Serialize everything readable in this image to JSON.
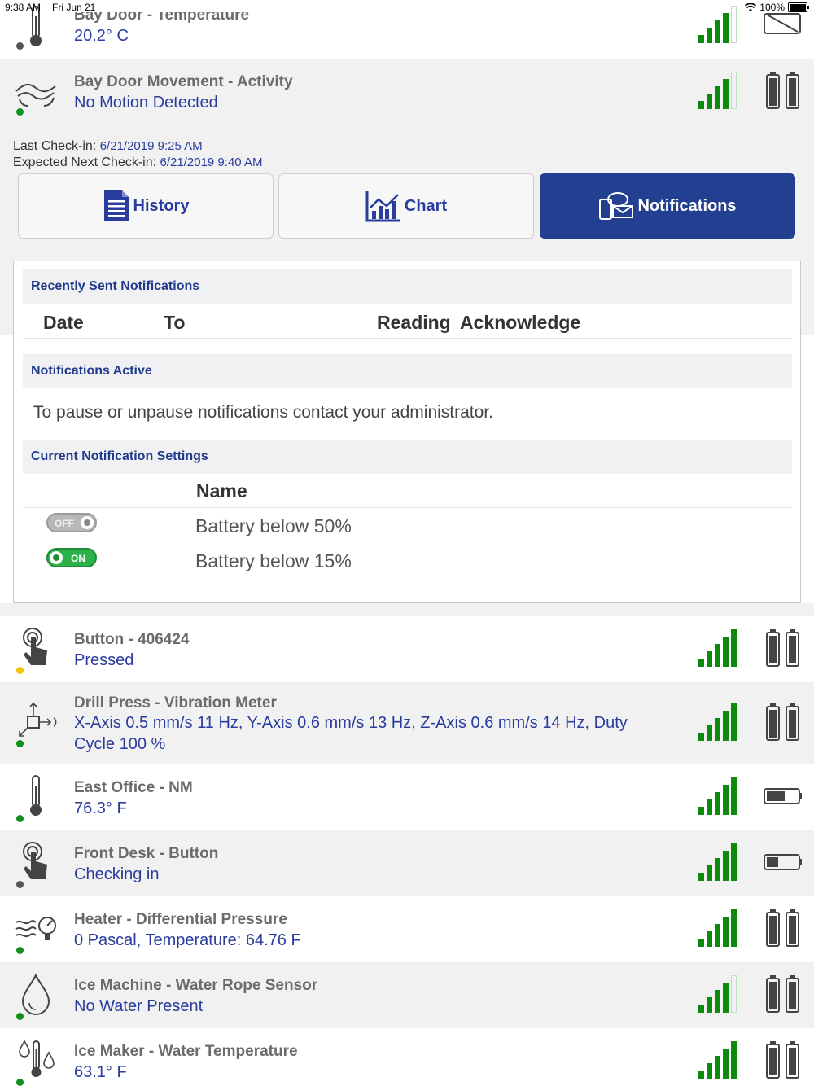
{
  "status": {
    "time": "9:38 AM",
    "date": "Fri Jun 21",
    "battery_pct": "100%"
  },
  "colors": {
    "accent": "#233f91",
    "reading": "#2a3c9e",
    "signal": "#0b8a0b",
    "dot_green": "#0f8f1c",
    "dot_gray": "#555555",
    "dot_yellow": "#f2c500"
  },
  "top_sensor": {
    "title": "Bay Door - Temperature",
    "reading": "20.2° C",
    "icon": "thermometer-icon",
    "status": "gray"
  },
  "selected_sensor": {
    "title": "Bay Door Movement - Activity",
    "reading": "No Motion Detected",
    "icon": "motion-icon",
    "status": "green"
  },
  "checkin": {
    "last_label": "Last Check-in:",
    "last_value": "6/21/2019 9:25 AM",
    "next_label": "Expected Next Check-in:",
    "next_value": "6/21/2019 9:40 AM"
  },
  "tabs": [
    {
      "label": "History",
      "icon": "document-icon"
    },
    {
      "label": "Chart",
      "icon": "chart-icon"
    },
    {
      "label": "Notifications",
      "icon": "notifications-icon",
      "active": true
    }
  ],
  "notifications": {
    "recent_heading": "Recently Sent Notifications",
    "columns": [
      "Date",
      "To",
      "Reading",
      "Acknowledge"
    ],
    "active_heading": "Notifications Active",
    "active_text": "To pause or unpause notifications contact your administrator.",
    "settings_heading": "Current Notification Settings",
    "settings_column": "Name",
    "settings": [
      {
        "state": "OFF",
        "name": "Battery below 50%"
      },
      {
        "state": "ON",
        "name": "Battery below 15%"
      }
    ]
  },
  "sensors": [
    {
      "title": "Button - 406424",
      "reading": "Pressed",
      "icon": "button-press-icon",
      "status": "yellow",
      "signal_bars": 5,
      "battery": "full-icon"
    },
    {
      "title": "Drill Press - Vibration Meter",
      "reading": "X-Axis 0.5 mm/s 11 Hz, Y-Axis 0.6 mm/s 13 Hz, Z-Axis 0.6 mm/s 14 Hz, Duty Cycle 100 %",
      "icon": "vibration-icon",
      "status": "green",
      "signal_bars": 5,
      "battery": "full-icon"
    },
    {
      "title": "East Office - NM",
      "reading": "76.3° F",
      "icon": "thermometer-icon",
      "status": "green",
      "signal_bars": 5,
      "battery": "coin-cell-icon"
    },
    {
      "title": "Front Desk - Button",
      "reading": "Checking in",
      "icon": "button-press-icon",
      "status": "gray",
      "signal_bars": 5,
      "battery": "coin-cell-icon"
    },
    {
      "title": "Heater - Differential Pressure",
      "reading": "0 Pascal, Temperature: 64.76 F",
      "icon": "pressure-icon",
      "status": "green",
      "signal_bars": 5,
      "battery": "full-icon"
    },
    {
      "title": "Ice Machine - Water Rope Sensor",
      "reading": "No Water Present",
      "icon": "water-drop-icon",
      "status": "green",
      "signal_bars": 4,
      "battery": "full-icon"
    },
    {
      "title": "Ice Maker - Water Temperature",
      "reading": "63.1° F",
      "icon": "water-temperature-icon",
      "status": "green",
      "signal_bars": 5,
      "battery": "full-icon"
    }
  ]
}
